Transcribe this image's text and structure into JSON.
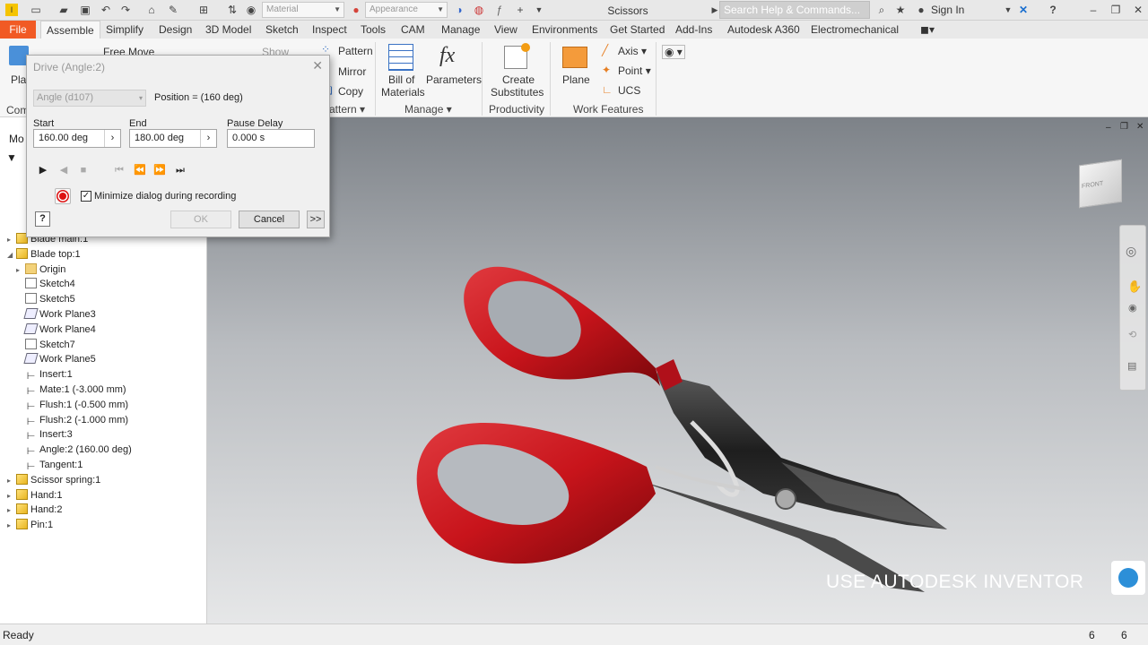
{
  "app": {
    "title": "Scissors",
    "material_combo": "Material",
    "appearance_combo": "Appearance",
    "help_search": "Search Help & Commands...",
    "sign_in": "Sign In"
  },
  "menu": {
    "tabs": [
      "File",
      "Assemble",
      "Simplify",
      "Design",
      "3D Model",
      "Sketch",
      "Inspect",
      "Tools",
      "CAM",
      "Manage",
      "View",
      "Environments",
      "Get Started",
      "Add-Ins",
      "Autodesk A360",
      "Electromechanical"
    ],
    "active": "Assemble"
  },
  "ribbon": {
    "free_move": "Free Move",
    "show": "Show",
    "pattern": "Pattern",
    "mirror": "Mirror",
    "copy": "Copy",
    "pattern_group": "attern",
    "bill_line1": "Bill of",
    "bill_line2": "Materials",
    "parameters": "Parameters",
    "manage_group": "Manage",
    "create_line1": "Create",
    "create_line2": "Substitutes",
    "productivity_group": "Productivity",
    "plane": "Plane",
    "axis": "Axis",
    "point": "Point",
    "ucs": "UCS",
    "work_features_group": "Work Features",
    "fx_icon": "fx",
    "pl_cut": "Pla",
    "com_cut": "Com"
  },
  "browser": {
    "header": "Mo",
    "items": [
      {
        "label": "Blade main:1",
        "icon": "part",
        "indent": 0,
        "tw": "▸"
      },
      {
        "label": "Blade top:1",
        "icon": "part",
        "indent": 0,
        "tw": "◢"
      },
      {
        "label": "Origin",
        "icon": "folder",
        "indent": 1,
        "tw": "▸"
      },
      {
        "label": "Sketch4",
        "icon": "sketch",
        "indent": 1,
        "tw": ""
      },
      {
        "label": "Sketch5",
        "icon": "sketch",
        "indent": 1,
        "tw": ""
      },
      {
        "label": "Work Plane3",
        "icon": "plane",
        "indent": 1,
        "tw": ""
      },
      {
        "label": "Work Plane4",
        "icon": "plane",
        "indent": 1,
        "tw": ""
      },
      {
        "label": "Sketch7",
        "icon": "sketch",
        "indent": 1,
        "tw": ""
      },
      {
        "label": "Work Plane5",
        "icon": "plane",
        "indent": 1,
        "tw": ""
      },
      {
        "label": "Insert:1",
        "icon": "constraint",
        "indent": 1,
        "tw": ""
      },
      {
        "label": "Mate:1 (-3.000 mm)",
        "icon": "constraint",
        "indent": 1,
        "tw": ""
      },
      {
        "label": "Flush:1 (-0.500 mm)",
        "icon": "constraint",
        "indent": 1,
        "tw": ""
      },
      {
        "label": "Flush:2 (-1.000 mm)",
        "icon": "constraint",
        "indent": 1,
        "tw": ""
      },
      {
        "label": "Insert:3",
        "icon": "constraint",
        "indent": 1,
        "tw": ""
      },
      {
        "label": "Angle:2 (160.00 deg)",
        "icon": "constraint",
        "indent": 1,
        "tw": ""
      },
      {
        "label": "Tangent:1",
        "icon": "constraint",
        "indent": 1,
        "tw": ""
      },
      {
        "label": "Scissor spring:1",
        "icon": "part",
        "indent": 0,
        "tw": "▸"
      },
      {
        "label": "Hand:1",
        "icon": "part",
        "indent": 0,
        "tw": "▸"
      },
      {
        "label": "Hand:2",
        "icon": "part",
        "indent": 0,
        "tw": "▸"
      },
      {
        "label": "Pin:1",
        "icon": "part",
        "indent": 0,
        "tw": "▸"
      }
    ]
  },
  "dialog": {
    "title": "Drive (Angle:2)",
    "constraint_select": "Angle (d107)",
    "position": "Position = (160 deg)",
    "start_label": "Start",
    "start_value": "160.00 deg",
    "end_label": "End",
    "end_value": "180.00 deg",
    "pause_label": "Pause Delay",
    "pause_value": "0.000 s",
    "minimize_label": "Minimize dialog during recording",
    "minimize_checked": true,
    "ok": "OK",
    "cancel": "Cancel",
    "more": ">>"
  },
  "viewport": {
    "watermark": "USE AUTODESK INVENTOR",
    "viewcube_label": "FRONT"
  },
  "status": {
    "text": "Ready",
    "num1": "6",
    "num2": "6"
  },
  "colors": {
    "file_tab": "#f15a24",
    "handle_red": "#c8141b",
    "blade_dark": "#2a2a2a"
  }
}
